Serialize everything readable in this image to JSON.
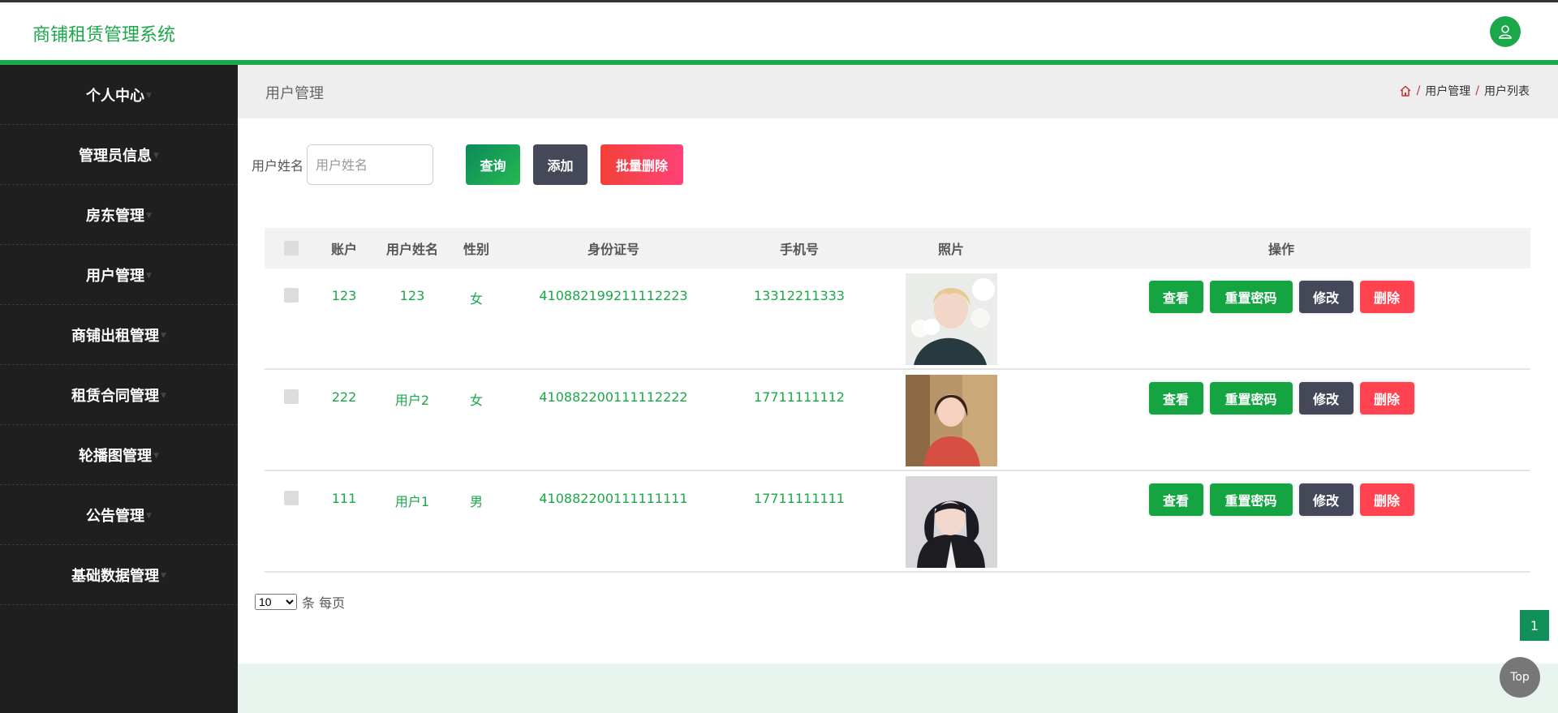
{
  "app": {
    "title": "商铺租赁管理系统"
  },
  "header": {
    "user_icon": "user-icon"
  },
  "sidebar": {
    "items": [
      {
        "label": "个人中心"
      },
      {
        "label": "管理员信息"
      },
      {
        "label": "房东管理"
      },
      {
        "label": "用户管理"
      },
      {
        "label": "商铺出租管理"
      },
      {
        "label": "租赁合同管理"
      },
      {
        "label": "轮播图管理"
      },
      {
        "label": "公告管理"
      },
      {
        "label": "基础数据管理"
      }
    ]
  },
  "breadcrumb": {
    "page_title": "用户管理",
    "home_icon": "home-icon",
    "items": [
      "用户管理",
      "用户列表"
    ],
    "separator": "/"
  },
  "search": {
    "label": "用户姓名",
    "placeholder": "用户姓名",
    "value": "",
    "query_label": "查询",
    "add_label": "添加",
    "batch_delete_label": "批量删除"
  },
  "table": {
    "headers": {
      "account": "账户",
      "name": "用户姓名",
      "gender": "性别",
      "id_number": "身份证号",
      "phone": "手机号",
      "photo": "照片",
      "actions": "操作"
    },
    "rows": [
      {
        "account": "123",
        "name": "123",
        "gender": "女",
        "id_number": "410882199211112223",
        "phone": "13312211333"
      },
      {
        "account": "222",
        "name": "用户2",
        "gender": "女",
        "id_number": "410882200111112222",
        "phone": "17711111112"
      },
      {
        "account": "111",
        "name": "用户1",
        "gender": "男",
        "id_number": "410882200111111111",
        "phone": "17711111111"
      }
    ],
    "actions": {
      "view": "查看",
      "reset_password": "重置密码",
      "edit": "修改",
      "delete": "删除"
    }
  },
  "pagination": {
    "page_size": "10",
    "page_size_options": [
      "10"
    ],
    "page_size_suffix": "条 每页",
    "current_page": "1"
  },
  "scroll_top": {
    "label": "Top"
  },
  "colors": {
    "accent": "#1aa84a",
    "sidebar_bg": "#1f1f1f",
    "danger": "#ff4351",
    "dark": "#444859"
  }
}
